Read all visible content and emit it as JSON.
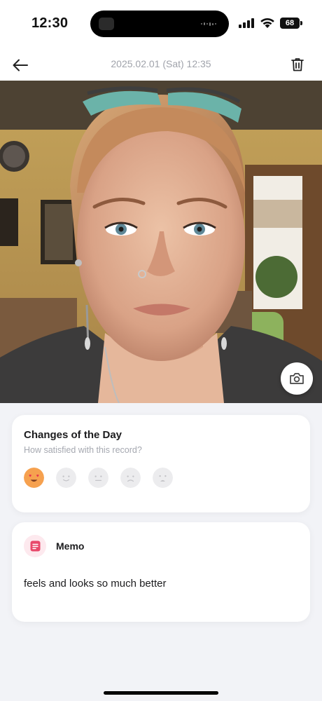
{
  "status_bar": {
    "time": "12:30",
    "battery": "68"
  },
  "header": {
    "date": "2025.02.01 (Sat) 12:35",
    "back_icon": "arrow-left-icon",
    "delete_icon": "trash-icon"
  },
  "photo": {
    "camera_icon": "camera-icon"
  },
  "changes_card": {
    "title": "Changes of the Day",
    "subtitle": "How satisfied with this record?",
    "ratings": [
      {
        "name": "love",
        "selected": true,
        "color": "#f6a14f"
      },
      {
        "name": "smile",
        "selected": false,
        "color": "#ececee"
      },
      {
        "name": "neutral",
        "selected": false,
        "color": "#ececee"
      },
      {
        "name": "sad",
        "selected": false,
        "color": "#ececee"
      },
      {
        "name": "upset",
        "selected": false,
        "color": "#ececee"
      }
    ]
  },
  "memo_card": {
    "title": "Memo",
    "text": "feels and looks so much better",
    "icon": "memo-icon",
    "icon_color": "#e8486a"
  }
}
